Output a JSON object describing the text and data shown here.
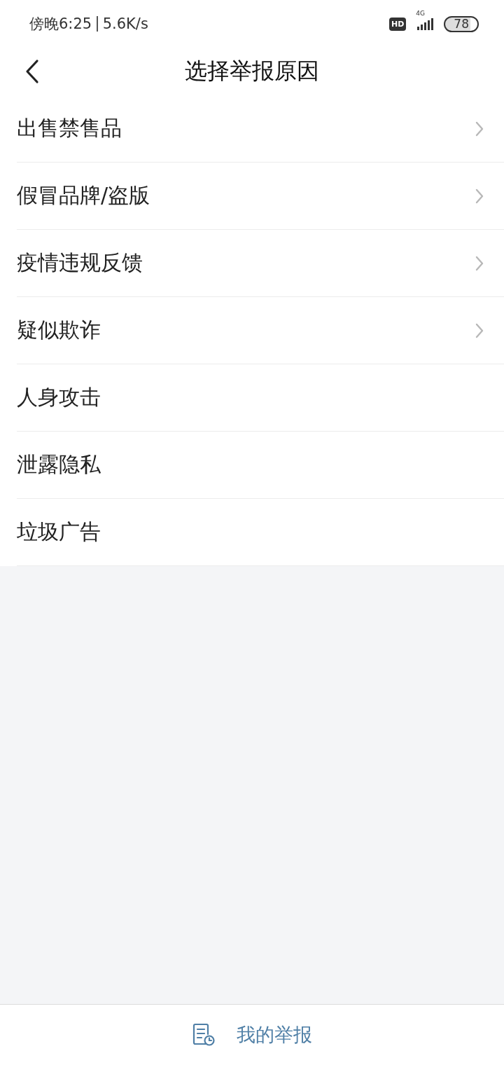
{
  "status_bar": {
    "time": "傍晚6:25",
    "speed": "5.6K/s",
    "hd": "HD",
    "network": "4G",
    "battery": "78"
  },
  "header": {
    "title": "选择举报原因"
  },
  "reasons": [
    {
      "label": "出售禁售品",
      "has_arrow": true
    },
    {
      "label": "假冒品牌/盗版",
      "has_arrow": true
    },
    {
      "label": "疫情违规反馈",
      "has_arrow": true
    },
    {
      "label": "疑似欺诈",
      "has_arrow": true
    },
    {
      "label": "人身攻击",
      "has_arrow": false
    },
    {
      "label": "泄露隐私",
      "has_arrow": false
    },
    {
      "label": "垃圾广告",
      "has_arrow": false
    }
  ],
  "bottom_bar": {
    "label": "我的举报"
  }
}
